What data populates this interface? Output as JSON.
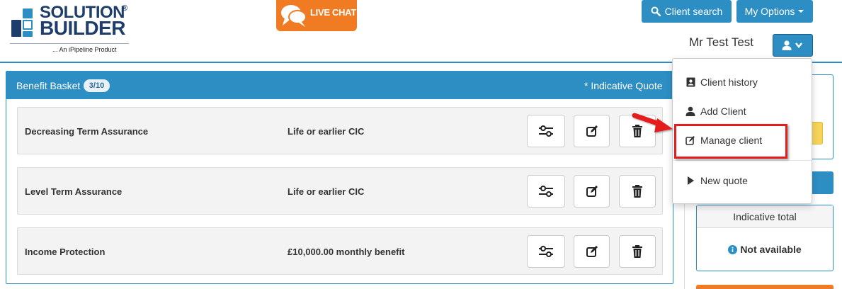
{
  "brand": {
    "line1": "SOLUTION",
    "line2": "BUILDER",
    "reg": "®",
    "tagline": "... An iPipeline Product"
  },
  "livechat": {
    "label": "LIVE CHAT"
  },
  "header": {
    "client_search": "Client search",
    "my_options": "My Options",
    "user_name": "Mr Test Test"
  },
  "basket": {
    "title": "Benefit Basket",
    "count": "3/10",
    "note": "* Indicative Quote",
    "rows": [
      {
        "product": "Decreasing Term Assurance",
        "benefit": "Life or earlier CIC"
      },
      {
        "product": "Level Term Assurance",
        "benefit": "Life or earlier CIC"
      },
      {
        "product": "Income Protection",
        "benefit": "£10,000.00 monthly benefit"
      }
    ]
  },
  "summary": {
    "title": "Indicative total",
    "value": "Not available"
  },
  "user_menu": {
    "items": [
      {
        "label": "Client history",
        "icon": "address-book-icon"
      },
      {
        "label": "Add Client",
        "icon": "user-icon"
      },
      {
        "label": "Manage client",
        "icon": "edit-icon"
      },
      {
        "label": "New quote",
        "icon": "play-icon"
      }
    ],
    "highlighted": "Manage client"
  },
  "colors": {
    "primary": "#2d8ec4",
    "orange": "#f17b22",
    "highlight": "#e41c1c",
    "navy": "#1f3d6b"
  }
}
